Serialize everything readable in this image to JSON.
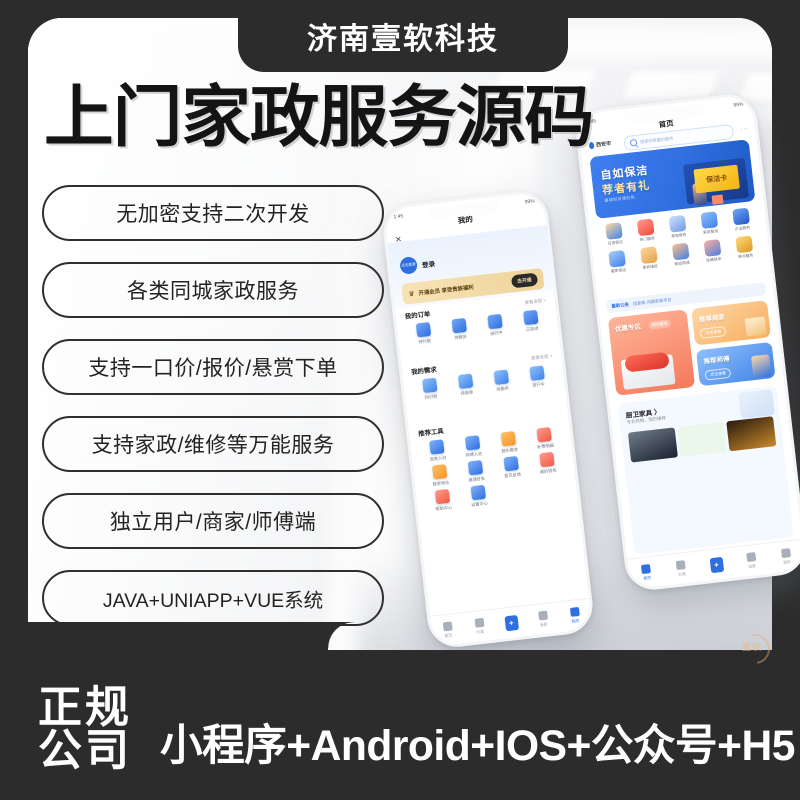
{
  "brand": {
    "company_badge": "济南壹软科技",
    "watermark": "壹软"
  },
  "headline": "上门家政服务源码",
  "features": [
    "无加密支持二次开发",
    "各类同城家政服务",
    "支持一口价/报价/悬赏下单",
    "支持家政/维修等万能服务",
    "独立用户/商家/师傅端",
    "JAVA+UNIAPP+VUE系统"
  ],
  "footer": {
    "legal_line1": "正规",
    "legal_line2": "公司",
    "platforms": "小程序+Android+IOS+公众号+H5"
  },
  "phone_left": {
    "title": "我的",
    "close_icon": "✕",
    "status_left": "1:45",
    "status_right": "99%",
    "user_name": "登录",
    "avatar_text": "点击登录",
    "vip_text": "开通会员 享受贵族福利",
    "vip_button": "去开通",
    "orders": {
      "title": "我的订单",
      "more": "查看全部 >",
      "items": [
        "待付款",
        "待服务",
        "进行中",
        "已完成"
      ]
    },
    "demands": {
      "title": "我的需求",
      "more": "查看全部 >",
      "items": [
        "待付款",
        "待报单",
        "待服务",
        "进行中"
      ]
    },
    "tools": {
      "title": "推荐工具",
      "items": [
        "商家入驻",
        "师傅入驻",
        "我的需求",
        "补费明细",
        "我家地址",
        "邀请好友",
        "意见反馈",
        "我的钱包",
        "帮助中心",
        "设置中心"
      ]
    },
    "tabs": [
      "首页",
      "分类",
      "消息",
      "我的"
    ],
    "tab_center": "+"
  },
  "phone_right": {
    "title": "首页",
    "status_left": "1:45",
    "status_right": "99%",
    "location": "西安市",
    "search_placeholder": "搜索你需要的服务",
    "more_icon": "···",
    "banner": {
      "line1": "自如保洁",
      "line2": "荐者有礼",
      "line3": "邀请好友领红包",
      "card_text": "保洁卡"
    },
    "categories": [
      "日常保洁",
      "热门服务",
      "家电维修",
      "家具服务",
      "企业服务",
      "搬家保洁",
      "家具维修",
      "管道疏通",
      "除螨除甲",
      "钟点服务"
    ],
    "notice": {
      "tag": "最新公告",
      "text": "找家政 问我家政平台"
    },
    "promos": {
      "big_title": "优惠专区",
      "big_tag": "精选服务",
      "card1_title": "推荐商家",
      "card1_button": "点击查看",
      "card2_title": "推荐师傅",
      "card2_button": "点击查看"
    },
    "furniture": {
      "title": "厨卫家具 〉",
      "subtitle": "专业热销，强烈推荐"
    },
    "tabs": [
      "首页",
      "分类",
      "消息",
      "我的"
    ],
    "tab_center": "+"
  },
  "colors": {
    "dark": "#2c2c2c",
    "accent_blue": "#2f6fe0",
    "gold": "#efd49b",
    "orange": "#f4795a"
  }
}
